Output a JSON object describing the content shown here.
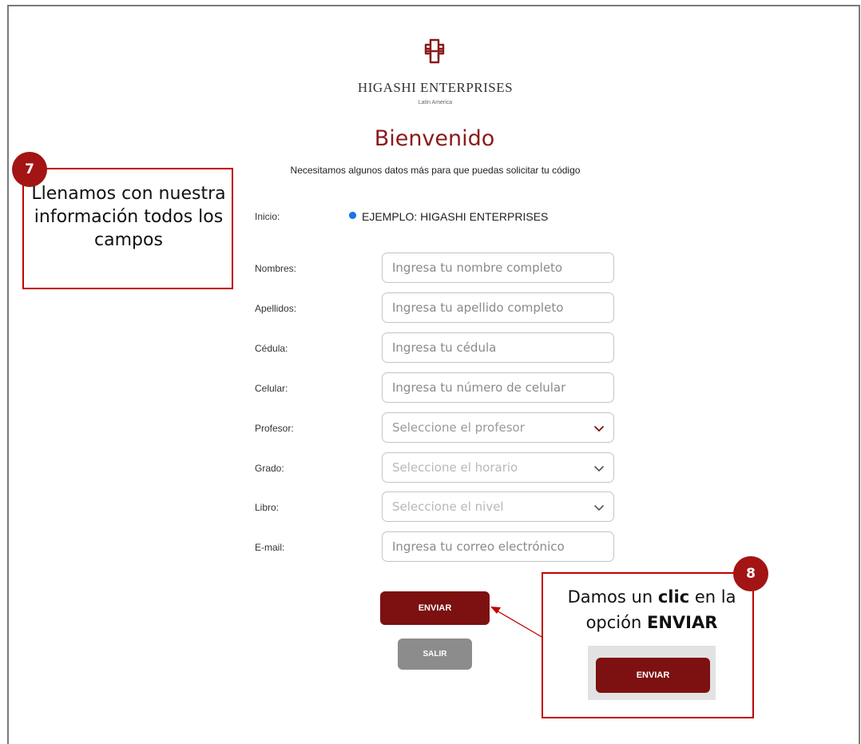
{
  "brand": {
    "name": "HIGASHI ENTERPRISES",
    "region": "Latin America"
  },
  "header": {
    "welcome": "Bienvenido",
    "subtitle": "Necesitamos algunos datos más para que puedas solicitar tu código"
  },
  "form": {
    "inicio": {
      "label": "Inicio:",
      "option": "EJEMPLO: HIGASHI ENTERPRISES",
      "selected": true
    },
    "nombres": {
      "label": "Nombres:",
      "placeholder": "Ingresa tu nombre completo"
    },
    "apellidos": {
      "label": "Apellidos:",
      "placeholder": "Ingresa tu apellido completo"
    },
    "cedula": {
      "label": "Cédula:",
      "placeholder": "Ingresa tu cédula"
    },
    "celular": {
      "label": "Celular:",
      "placeholder": "Ingresa tu número de celular"
    },
    "profesor": {
      "label": "Profesor:",
      "selected": "Seleccione el profesor"
    },
    "grado": {
      "label": "Grado:",
      "selected": "Seleccione el horario"
    },
    "libro": {
      "label": "Libro:",
      "selected": "Seleccione el nivel"
    },
    "email": {
      "label": "E-mail:",
      "placeholder": "Ingresa tu correo electrónico"
    },
    "submit_label": "ENVIAR",
    "exit_label": "SALIR"
  },
  "callouts": {
    "step7": {
      "number": "7",
      "text": "Llenamos con nuestra información todos los campos"
    },
    "step8": {
      "number": "8",
      "text_prefix": "Damos un",
      "text_bold1": "clic",
      "text_mid": "en la opción",
      "text_bold2": "ENVIAR",
      "button_label": "ENVIAR"
    }
  },
  "colors": {
    "brand": "#7d1010",
    "accent_title": "#8b1a1a",
    "callout_border": "#c00000",
    "badge": "#a31414",
    "exit_button": "#8c8c8c",
    "radio": "#1a73e8"
  },
  "icons": {
    "logo": "higashi-knot-logo",
    "select_chevron": "chevron-down-icon",
    "arrow": "pointer-arrow"
  }
}
